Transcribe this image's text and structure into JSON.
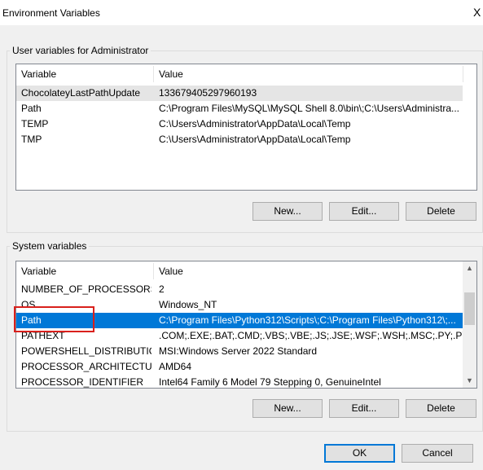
{
  "window": {
    "title": "Environment Variables",
    "close_glyph": "X"
  },
  "user_vars": {
    "label": "User variables for Administrator",
    "columns": [
      "Variable",
      "Value"
    ],
    "rows": [
      {
        "variable": "ChocolateyLastPathUpdate",
        "value": "133679405297960193"
      },
      {
        "variable": "Path",
        "value": "C:\\Program Files\\MySQL\\MySQL Shell 8.0\\bin\\;C:\\Users\\Administra..."
      },
      {
        "variable": "TEMP",
        "value": "C:\\Users\\Administrator\\AppData\\Local\\Temp"
      },
      {
        "variable": "TMP",
        "value": "C:\\Users\\Administrator\\AppData\\Local\\Temp"
      }
    ],
    "buttons": {
      "new": "New...",
      "edit": "Edit...",
      "delete": "Delete"
    }
  },
  "system_vars": {
    "label": "System variables",
    "columns": [
      "Variable",
      "Value"
    ],
    "rows": [
      {
        "variable": "NUMBER_OF_PROCESSORS",
        "value": "2"
      },
      {
        "variable": "OS",
        "value": "Windows_NT"
      },
      {
        "variable": "Path",
        "value": "C:\\Program Files\\Python312\\Scripts\\;C:\\Program Files\\Python312\\;..."
      },
      {
        "variable": "PATHEXT",
        "value": ".COM;.EXE;.BAT;.CMD;.VBS;.VBE;.JS;.JSE;.WSF;.WSH;.MSC;.PY;.PYW"
      },
      {
        "variable": "POWERSHELL_DISTRIBUTIO...",
        "value": "MSI:Windows Server 2022 Standard"
      },
      {
        "variable": "PROCESSOR_ARCHITECTURE",
        "value": "AMD64"
      },
      {
        "variable": "PROCESSOR_IDENTIFIER",
        "value": "Intel64 Family 6 Model 79 Stepping 0, GenuineIntel"
      }
    ],
    "selected_index": 2,
    "scroll_up_glyph": "▲",
    "scroll_down_glyph": "▼",
    "buttons": {
      "new": "New...",
      "edit": "Edit...",
      "delete": "Delete"
    }
  },
  "footer": {
    "ok": "OK",
    "cancel": "Cancel"
  },
  "colors": {
    "selection": "#0078d7",
    "highlight_box": "#d9201c",
    "dialog_bg": "#f0f0f0"
  }
}
